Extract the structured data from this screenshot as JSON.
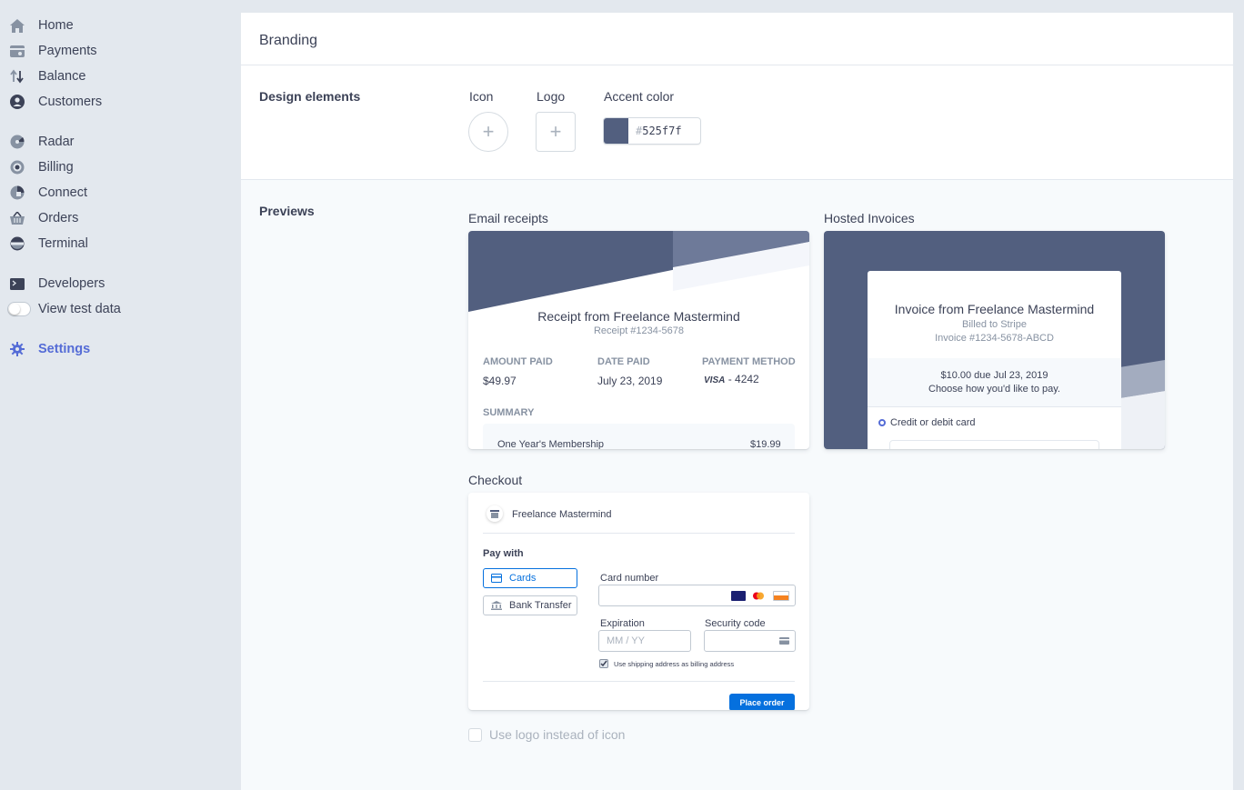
{
  "sidebar": {
    "items": [
      {
        "label": "Home",
        "icon": "home-icon"
      },
      {
        "label": "Payments",
        "icon": "payments-icon"
      },
      {
        "label": "Balance",
        "icon": "balance-icon"
      },
      {
        "label": "Customers",
        "icon": "customers-icon"
      },
      {
        "label": "Radar",
        "icon": "radar-icon"
      },
      {
        "label": "Billing",
        "icon": "billing-icon"
      },
      {
        "label": "Connect",
        "icon": "connect-icon"
      },
      {
        "label": "Orders",
        "icon": "orders-icon"
      },
      {
        "label": "Terminal",
        "icon": "terminal-icon"
      },
      {
        "label": "Developers",
        "icon": "developers-icon"
      },
      {
        "label": "View test data",
        "icon": "toggle"
      },
      {
        "label": "Settings",
        "icon": "gear-icon"
      }
    ],
    "active_item": "Settings"
  },
  "header": {
    "title": "Branding"
  },
  "design": {
    "section_label": "Design elements",
    "icon_label": "Icon",
    "logo_label": "Logo",
    "accent_label": "Accent color",
    "accent_hash": "#",
    "accent_value": "525f7f",
    "accent_color": "#525f7f"
  },
  "previews": {
    "section_label": "Previews",
    "email": {
      "label": "Email receipts",
      "title": "Receipt from Freelance Mastermind",
      "receipt_no": "Receipt #1234-5678",
      "amount_h": "AMOUNT PAID",
      "amount_v": "$49.97",
      "date_h": "DATE PAID",
      "date_v": "July 23, 2019",
      "method_h": "PAYMENT METHOD",
      "method_brand": "VISA",
      "method_v": "- 4242",
      "summary_h": "SUMMARY",
      "line_item": "One Year's Membership",
      "line_amount": "$19.99"
    },
    "invoice": {
      "label": "Hosted Invoices",
      "title": "Invoice from Freelance Mastermind",
      "billed_to": "Billed to Stripe",
      "invoice_no": "Invoice #1234-5678-ABCD",
      "due": "$10.00 due Jul 23, 2019",
      "choose": "Choose how you'd like to pay.",
      "option": "Credit or debit card"
    },
    "checkout": {
      "label": "Checkout",
      "merchant": "Freelance Mastermind",
      "pay_with": "Pay with",
      "cards": "Cards",
      "bank": "Bank Transfer",
      "card_number": "Card number",
      "expiration": "Expiration",
      "exp_placeholder": "MM / YY",
      "security": "Security code",
      "shipping_check": "Use shipping address as billing address",
      "place_order": "Place order",
      "button_color": "#0570de"
    },
    "logo_option": "Use logo instead of icon"
  }
}
